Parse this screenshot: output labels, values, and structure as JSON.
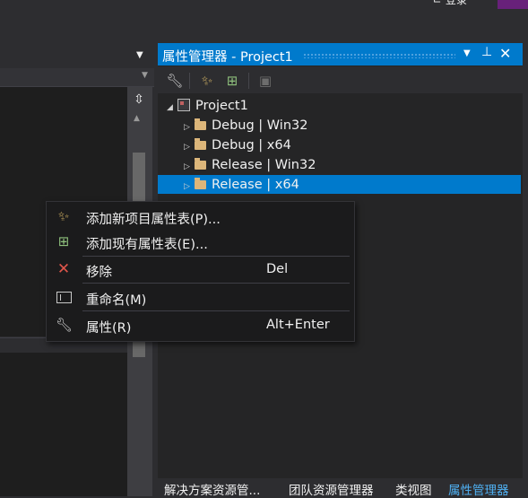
{
  "top": {
    "fragment_text": "ㄹ 登录",
    "accent_color": "#68217a"
  },
  "panel": {
    "title": "属性管理器 - Project1",
    "accent_color": "#007acc",
    "toolbar_icons": [
      "wrench-icon",
      "magic-wand-icon",
      "add-existing-icon",
      "save-icon"
    ],
    "tree": {
      "root": "Project1",
      "children": [
        "Debug | Win32",
        "Debug | x64",
        "Release | Win32",
        "Release | x64"
      ],
      "selected_index": 3
    }
  },
  "context_menu": {
    "items": [
      {
        "label": "添加新项目属性表(P)...",
        "shortcut": "",
        "icon": "magic-wand-icon"
      },
      {
        "label": "添加现有属性表(E)...",
        "shortcut": "",
        "icon": "add-existing-icon"
      },
      {
        "label": "移除",
        "shortcut": "Del",
        "icon": "remove-x-icon"
      },
      {
        "label": "重命名(M)",
        "shortcut": "",
        "icon": "rename-icon"
      },
      {
        "label": "属性(R)",
        "shortcut": "Alt+Enter",
        "icon": "wrench-icon"
      }
    ]
  },
  "bottom_tabs": [
    {
      "label": "解决方案资源管...",
      "active": false
    },
    {
      "label": "团队资源管理器",
      "active": false
    },
    {
      "label": "类视图",
      "active": false
    },
    {
      "label": "属性管理器",
      "active": true
    }
  ]
}
